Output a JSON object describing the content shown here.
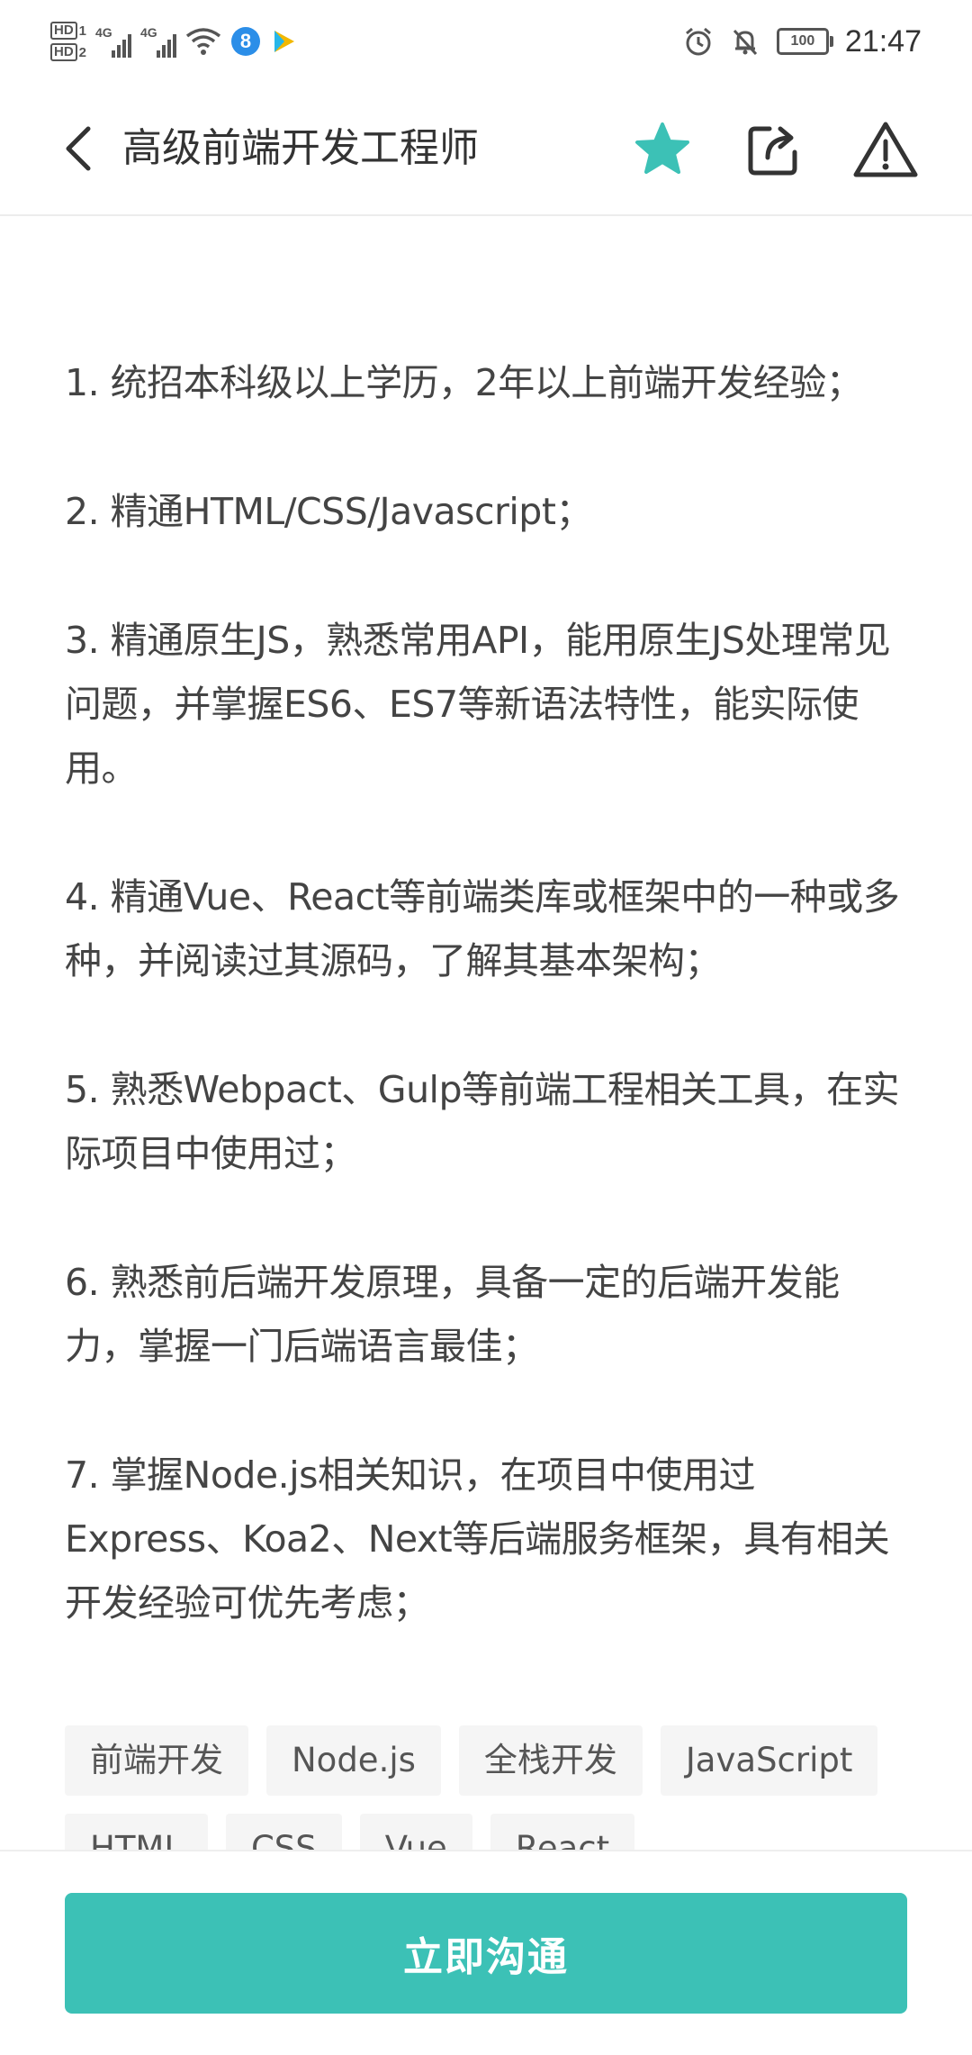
{
  "status_bar": {
    "hd1": "HD",
    "hd1_sub": "1",
    "hd2": "HD",
    "hd2_sub": "2",
    "net1": "4G",
    "net2": "4G",
    "battery": "100",
    "time": "21:47",
    "icons": [
      "wifi-icon",
      "app-8-icon",
      "play-icon",
      "alarm-icon",
      "bell-off-icon"
    ]
  },
  "header": {
    "title": "高级前端开发工程师",
    "icons": [
      "back-arrow-icon",
      "star-icon",
      "share-icon",
      "warning-icon"
    ]
  },
  "requirements": [
    "1. 统招本科级以上学历，2年以上前端开发经验；",
    "2. 精通HTML/CSS/Javascript；",
    "3. 精通原生JS，熟悉常用API，能用原生JS处理常见问题，并掌握ES6、ES7等新语法特性，能实际使用。",
    "4. 精通Vue、React等前端类库或框架中的一种或多种，并阅读过其源码，了解其基本架构；",
    "5. 熟悉Webpact、Gulp等前端工程相关工具，在实际项目中使用过；",
    "6. 熟悉前后端开发原理，具备一定的后端开发能力，掌握一门后端语言最佳；",
    "7. 掌握Node.js相关知识，在项目中使用过Express、Koa2、Next等后端服务框架，具有相关开发经验可优先考虑；"
  ],
  "tags": [
    "前端开发",
    "Node.js",
    "全栈开发",
    "JavaScript",
    "HTML",
    "CSS",
    "Vue",
    "React"
  ],
  "bottom": {
    "chat_label": "立即沟通"
  },
  "colors": {
    "accent": "#3cc1b6",
    "text": "#444444",
    "chip_bg": "#f5f5f5"
  }
}
